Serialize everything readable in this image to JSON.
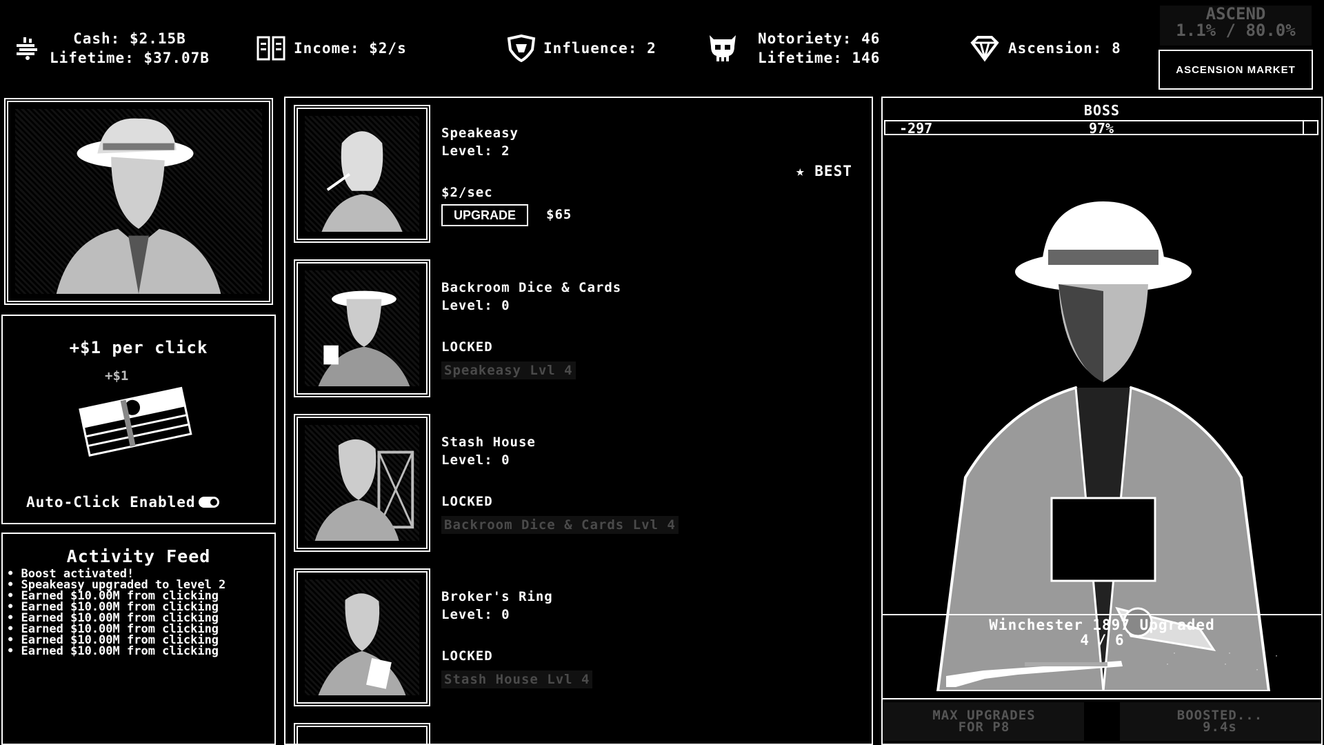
{
  "header": {
    "cash_label": "Cash: $2.15B",
    "lifetime_label": "Lifetime: $37.07B",
    "income_label": "Income: $2/s",
    "influence_label": "Influence: 2",
    "notoriety_label": "Notoriety: 46",
    "notoriety_lifetime_label": "Lifetime: 146",
    "ascension_label": "Ascension: 8",
    "ascend_title": "ASCEND",
    "ascend_progress": "1.1% / 80.0%",
    "ascension_market_label": "ASCENSION MARKET"
  },
  "icons": {
    "cash": "money-stack-icon",
    "income": "ledger-icon",
    "influence": "shield-icon",
    "notoriety": "skull-icon",
    "ascension": "diamond-icon"
  },
  "clicker": {
    "per_click_label": "+$1 per click",
    "float_text": "+$1",
    "auto_click_label": "Auto-Click Enabled",
    "auto_click_on": true
  },
  "feed": {
    "title": "Activity Feed",
    "items": [
      "• Boost activated!",
      "• Speakeasy upgraded to level 2",
      "• Earned $10.00M from clicking",
      "• Earned $10.00M from clicking",
      "• Earned $10.00M from clicking",
      "• Earned $10.00M from clicking",
      "• Earned $10.00M from clicking",
      "• Earned $10.00M from clicking"
    ]
  },
  "businesses": [
    {
      "name": "Speakeasy",
      "level": "Level: 2",
      "rate": "$2/sec",
      "upgrade_label": "UPGRADE",
      "cost": "$65",
      "best": "★ BEST",
      "locked": false
    },
    {
      "name": "Backroom Dice & Cards",
      "level": "Level: 0",
      "status": "LOCKED",
      "requirement": "Speakeasy Lvl 4",
      "locked": true
    },
    {
      "name": "Stash House",
      "level": "Level: 0",
      "status": "LOCKED",
      "requirement": "Backroom Dice & Cards Lvl 4",
      "locked": true
    },
    {
      "name": "Broker's Ring",
      "level": "Level: 0",
      "status": "LOCKED",
      "requirement": "Stash House Lvl 4",
      "locked": true
    }
  ],
  "boss": {
    "title": "BOSS",
    "damage": "-297",
    "health_percent_label": "97%",
    "health_fraction": 0.97,
    "weapon_name": "Winchester 1897 Upgraded",
    "weapon_progress": "4 / 6",
    "max_upgrades_line1": "MAX UPGRADES",
    "max_upgrades_line2": "FOR P8",
    "boosted_line1": "BOOSTED...",
    "boosted_line2": "9.4s"
  }
}
